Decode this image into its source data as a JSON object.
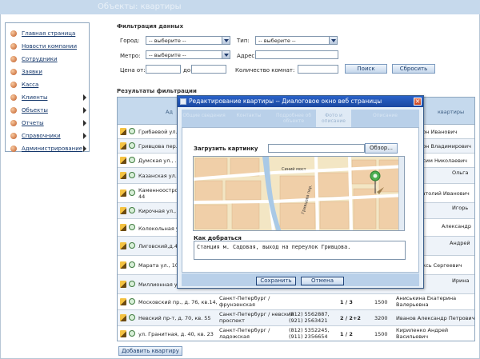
{
  "header": {
    "title": "Объекты: квартиры"
  },
  "sidebar": {
    "items": [
      {
        "label": "Главная страница",
        "has_submenu": false
      },
      {
        "label": "Новости компании",
        "has_submenu": false
      },
      {
        "label": "Сотрудники",
        "has_submenu": false
      },
      {
        "label": "Заявки",
        "has_submenu": false
      },
      {
        "label": "Касса",
        "has_submenu": false
      },
      {
        "label": "Клиенты",
        "has_submenu": true
      },
      {
        "label": "Объекты",
        "has_submenu": true
      },
      {
        "label": "Отчеты",
        "has_submenu": true
      },
      {
        "label": "Справочники",
        "has_submenu": true
      },
      {
        "label": "Администрирование",
        "has_submenu": true
      }
    ]
  },
  "filter": {
    "title": "Фильтрация данных",
    "city_label": "Город:",
    "city_value": "-- выберите --",
    "type_label": "Тип:",
    "type_value": "-- выберите --",
    "metro_label": "Метро:",
    "metro_value": "-- выберите --",
    "address_label": "Адрес:",
    "price_from_label": "Цена от:",
    "price_to_label": "до:",
    "rooms_label": "Количество комнат:",
    "search_button": "Поиск",
    "reset_button": "Сбросить"
  },
  "results": {
    "title": "Результаты фильтрации",
    "header_left": "Ад",
    "header_right": "квартиры",
    "rows": [
      {
        "address": "Грибаевой ул...",
        "agent": "...он Иванович",
        "agent2": ""
      },
      {
        "address": "Гривцова пер...",
        "agent": "...он Владимирович",
        "agent2": ""
      },
      {
        "address": "Думская ул., ...",
        "agent": "...сим Николаевич",
        "agent2": ""
      },
      {
        "address": "Казанская ул., ...",
        "agent": "Ольга",
        "agent2": ""
      },
      {
        "address": "Каменноостров... 44",
        "agent": "...натолий Иванович",
        "agent2": ""
      },
      {
        "address": "Кирочная ул., д...",
        "agent": "Игорь",
        "agent2": ""
      },
      {
        "address": "Колокольная ул...",
        "agent": "Александр",
        "agent2": ""
      },
      {
        "address": "Лиговский,д.40",
        "agent": "Андрей",
        "agent2": ""
      },
      {
        "address": "Марата ул., 10,",
        "agent": "...ксь Сергеевич",
        "agent2": ""
      },
      {
        "address": "Миллионная ул...",
        "agent": "Ирина",
        "agent2": ""
      },
      {
        "address": "Московский пр., д. 76, кв.14,",
        "city": "Санкт-Петербург / фрунзенская",
        "phone": "",
        "rooms": "1 / 3",
        "price": "1500",
        "agent": "Аниськина Екатерина Валерьевна"
      },
      {
        "address": "Невский пр-т, д. 70, кв. 55",
        "city": "Санкт-Петербург / невский проспект",
        "phone": "(812) 5562887, (921) 2563421",
        "rooms": "2 / 2+2",
        "price": "3200",
        "agent": "Иванов Александр Петрович"
      },
      {
        "address": "ул. Гранитная, д. 40, кв. 23",
        "city": "Санкт-Петербург / ладожская",
        "phone": "(812) 5352245, (911) 2356654",
        "rooms": "1 / 2",
        "price": "1500",
        "agent": "Кириленко Андрей Васильевич"
      }
    ],
    "add_button": "Добавить квартиру"
  },
  "modal": {
    "title": "Редактирование квартиры -- Диалоговое окно веб страницы",
    "tabs": [
      "Общие сведения",
      "Контакты",
      "Подробнее об объекте",
      "Фото и описание",
      "Описание"
    ],
    "upload_label": "Загрузить картинку",
    "browse_button": "Обзор...",
    "how_to_label": "Как добраться",
    "directions": "Станция м. Садовая, выход на переулок Гривцова.",
    "save_button": "Сохранить",
    "cancel_button": "Отмена",
    "map_label": "Синий мост",
    "map_street": "Гривцова пер."
  },
  "colors": {
    "header_band": "#c6d9ec",
    "link": "#14376b",
    "modal_title": "#2a62c8",
    "table_header": "#c5d9ed"
  }
}
